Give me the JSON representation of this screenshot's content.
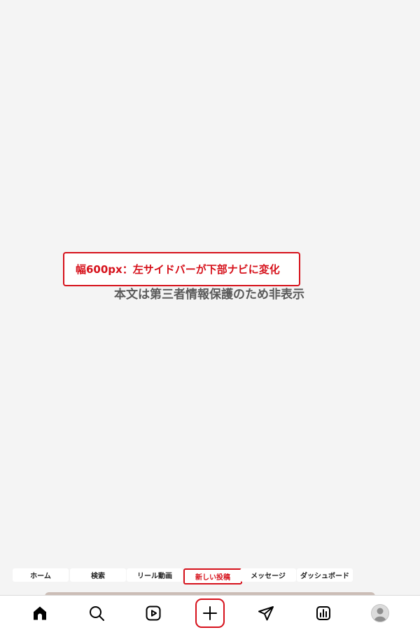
{
  "annotation": {
    "callout_text": "幅600px：左サイドバーが下部ナビに変化",
    "hidden_text": "本文は第三者情報保護のため非表示",
    "accent_color": "#d6111b"
  },
  "nav_labels": [
    {
      "label": "ホーム",
      "icon": "home-icon"
    },
    {
      "label": "検索",
      "icon": "search-icon"
    },
    {
      "label": "リール動画",
      "icon": "reels-icon"
    },
    {
      "label": "新しい投稿",
      "icon": "plus-icon",
      "highlighted": true
    },
    {
      "label": "メッセージ",
      "icon": "send-icon"
    },
    {
      "label": "ダッシュボード",
      "icon": "chart-icon"
    }
  ],
  "profile": {
    "icon": "avatar-icon"
  }
}
